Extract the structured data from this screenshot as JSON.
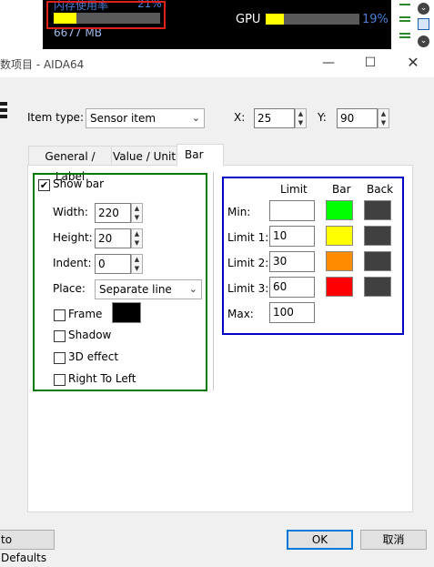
{
  "sensor_strip": {
    "mem_label": "内存使用率",
    "mem_percent": "21%",
    "mem_value": 21,
    "mem_mb": "6677 MB",
    "gpu_label": "GPU",
    "gpu_percent": "19%",
    "gpu_value": 19
  },
  "dialog": {
    "title": "数项目 - AIDA64",
    "item_type_label": "Item type:",
    "item_type_value": "Sensor item",
    "x_label": "X:",
    "x_value": "25",
    "y_label": "Y:",
    "y_value": "90",
    "tabs": [
      {
        "label": "General / Label",
        "active": false
      },
      {
        "label": "Value / Unit",
        "active": false
      },
      {
        "label": "Bar",
        "active": true
      }
    ],
    "bar_tab": {
      "show_bar_label": "Show bar",
      "show_bar_checked": true,
      "width_label": "Width:",
      "width_value": "220",
      "height_label": "Height:",
      "height_value": "20",
      "indent_label": "Indent:",
      "indent_value": "0",
      "place_label": "Place:",
      "place_value": "Separate line",
      "frame_label": "Frame",
      "frame_color": "#000000",
      "shadow_label": "Shadow",
      "effect3d_label": "3D effect",
      "rtl_label": "Right To Left",
      "limits_header": {
        "limit": "Limit",
        "bar": "Bar",
        "back": "Back"
      },
      "limits": [
        {
          "label": "Min:",
          "value": "",
          "bar_color": "#00ff00",
          "back_color": "#404040"
        },
        {
          "label": "Limit 1:",
          "value": "10",
          "bar_color": "#ffff00",
          "back_color": "#404040"
        },
        {
          "label": "Limit 2:",
          "value": "30",
          "bar_color": "#ff8c00",
          "back_color": "#404040"
        },
        {
          "label": "Limit 3:",
          "value": "60",
          "bar_color": "#ff0000",
          "back_color": "#404040"
        }
      ],
      "max_label": "Max:",
      "max_value": "100"
    },
    "buttons": {
      "defaults": "to Defaults",
      "ok": "OK",
      "cancel": "取消"
    }
  },
  "colors": {
    "green_group_border": "#007a00",
    "blue_group_border": "#0000c8",
    "ok_border": "#0078d7",
    "highlight_box": "#e0201a"
  }
}
